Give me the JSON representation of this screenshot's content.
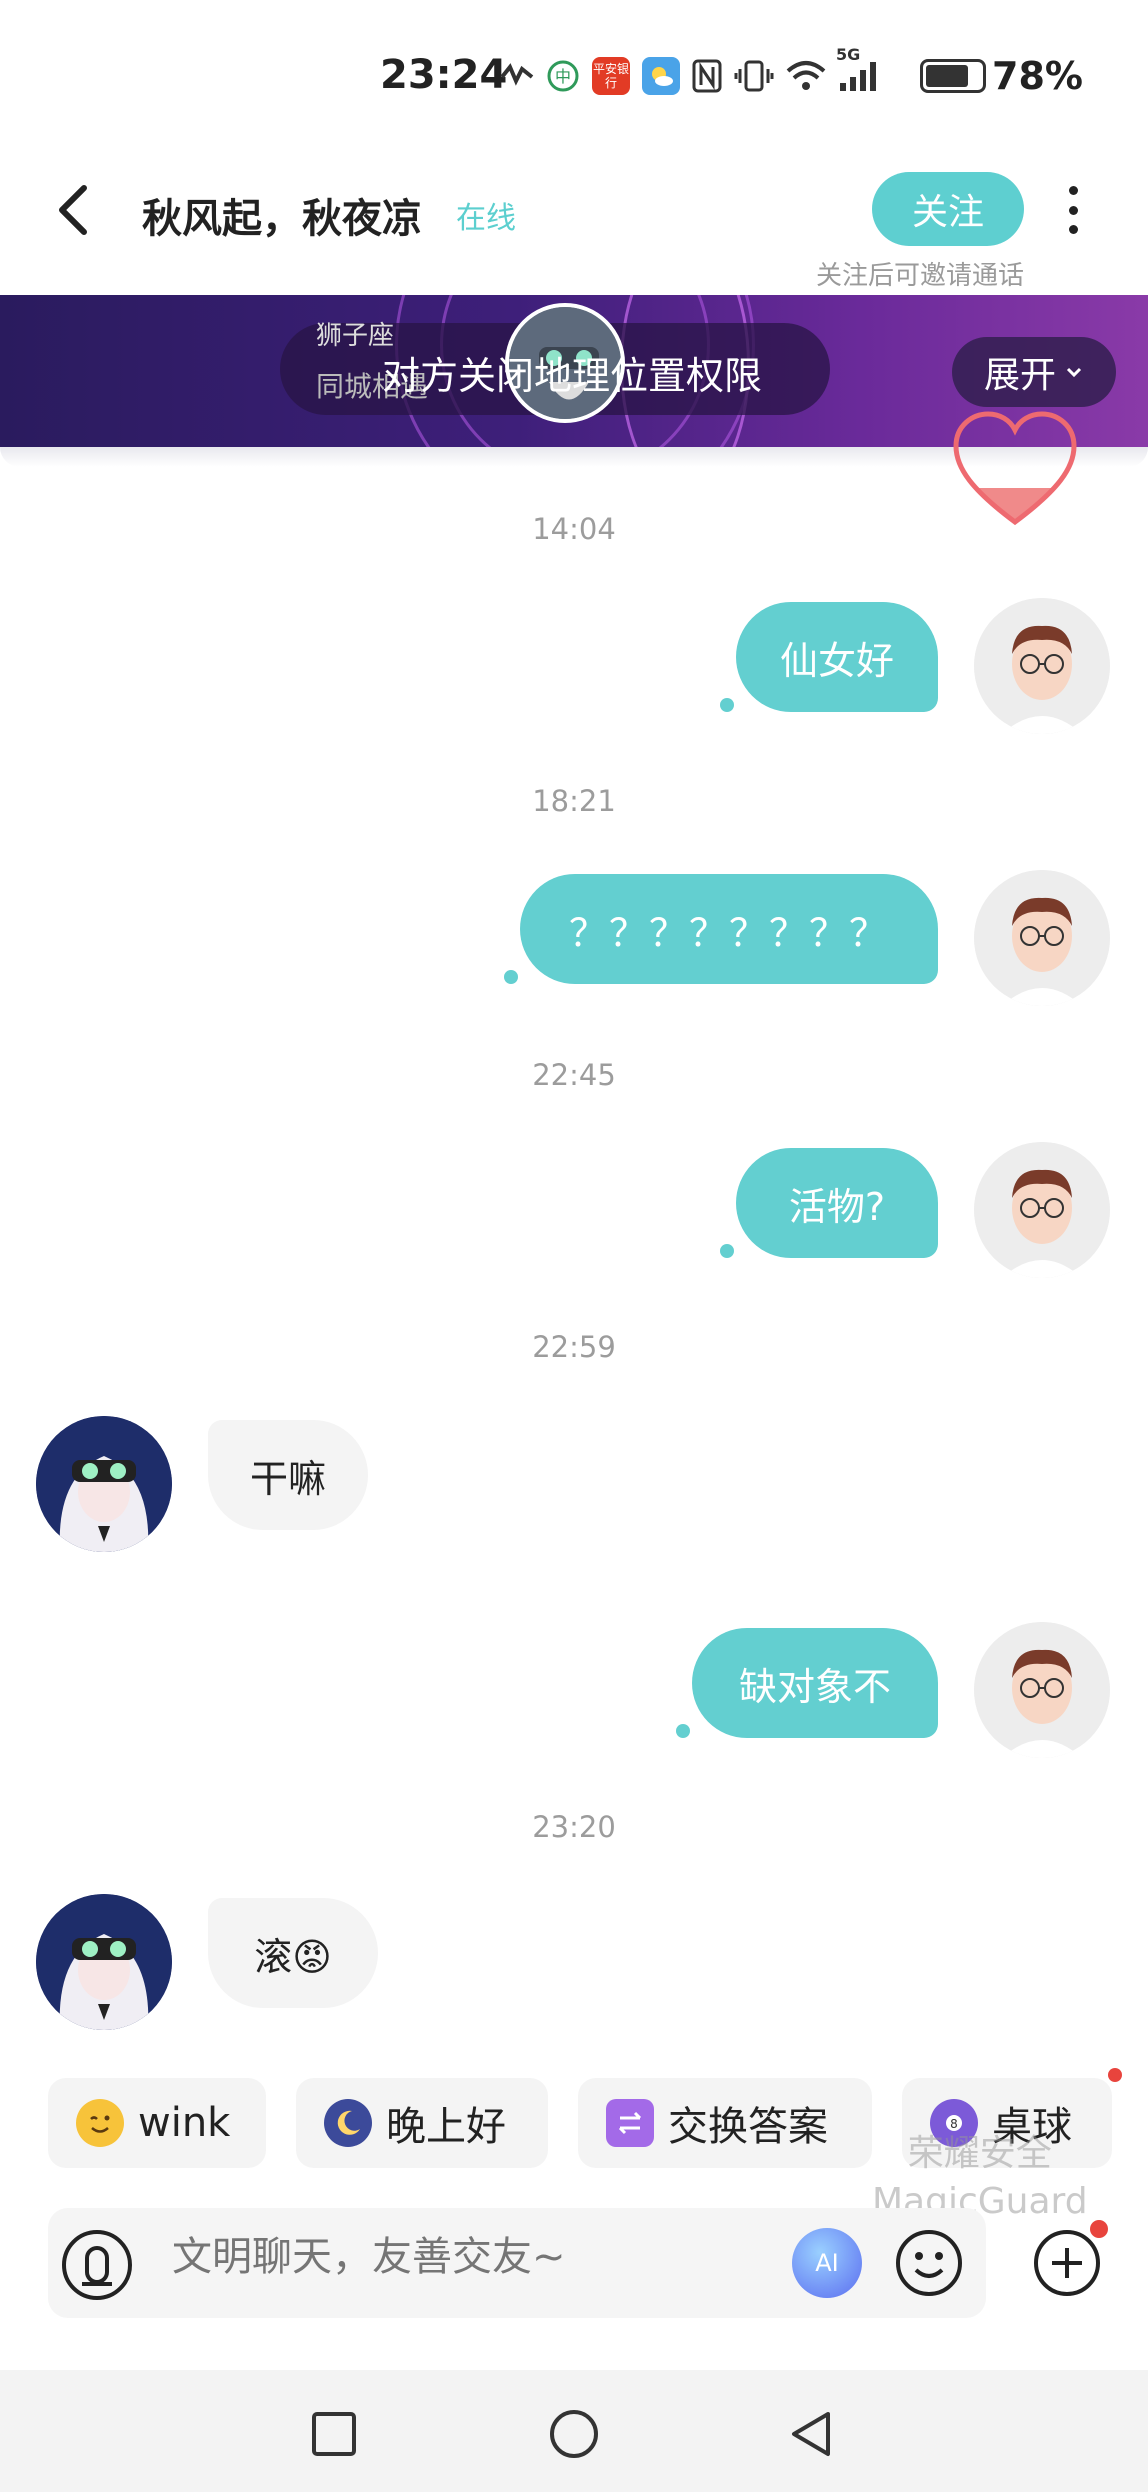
{
  "status_bar": {
    "time": "23:24",
    "battery": "78%",
    "battery_level": 0.78,
    "signal": "5G",
    "bank_badge": "平安银行"
  },
  "header": {
    "title": "秋风起，秋夜凉",
    "online_status": "在线",
    "follow_label": "关注",
    "follow_hint": "关注后可邀请通话"
  },
  "banner": {
    "zodiac": "狮子座",
    "same_city": "同城相遇",
    "location_notice": "对方关闭地理位置权限",
    "expand_label": "展开"
  },
  "messages": [
    {
      "time": "14:04",
      "sender": "me",
      "text": "仙女好"
    },
    {
      "time": "18:21",
      "sender": "me",
      "text": "？？？？？？？？"
    },
    {
      "time": "22:45",
      "sender": "me",
      "text": "活物?"
    },
    {
      "time": "22:59",
      "sender": "other",
      "text": "干嘛"
    },
    {
      "time": "",
      "sender": "me",
      "text": "缺对象不"
    },
    {
      "time": "23:20",
      "sender": "other",
      "text": "滚😡"
    }
  ],
  "quick_replies": [
    {
      "label": "wink",
      "icon": "wink-emoji-icon"
    },
    {
      "label": "晚上好",
      "icon": "moon-icon"
    },
    {
      "label": "交换答案",
      "icon": "swap-icon"
    },
    {
      "label": "桌球",
      "icon": "billiard-ball-icon"
    }
  ],
  "watermark": {
    "line1": "荣耀安全",
    "line2": "MagicGuard"
  },
  "input": {
    "placeholder": "文明聊天，友善交友~",
    "ai_label": "AI"
  },
  "colors": {
    "accent": "#63cfd0",
    "banner_start": "#2a1b5e",
    "banner_end": "#8a3aa8",
    "badge_red": "#e8443d"
  }
}
